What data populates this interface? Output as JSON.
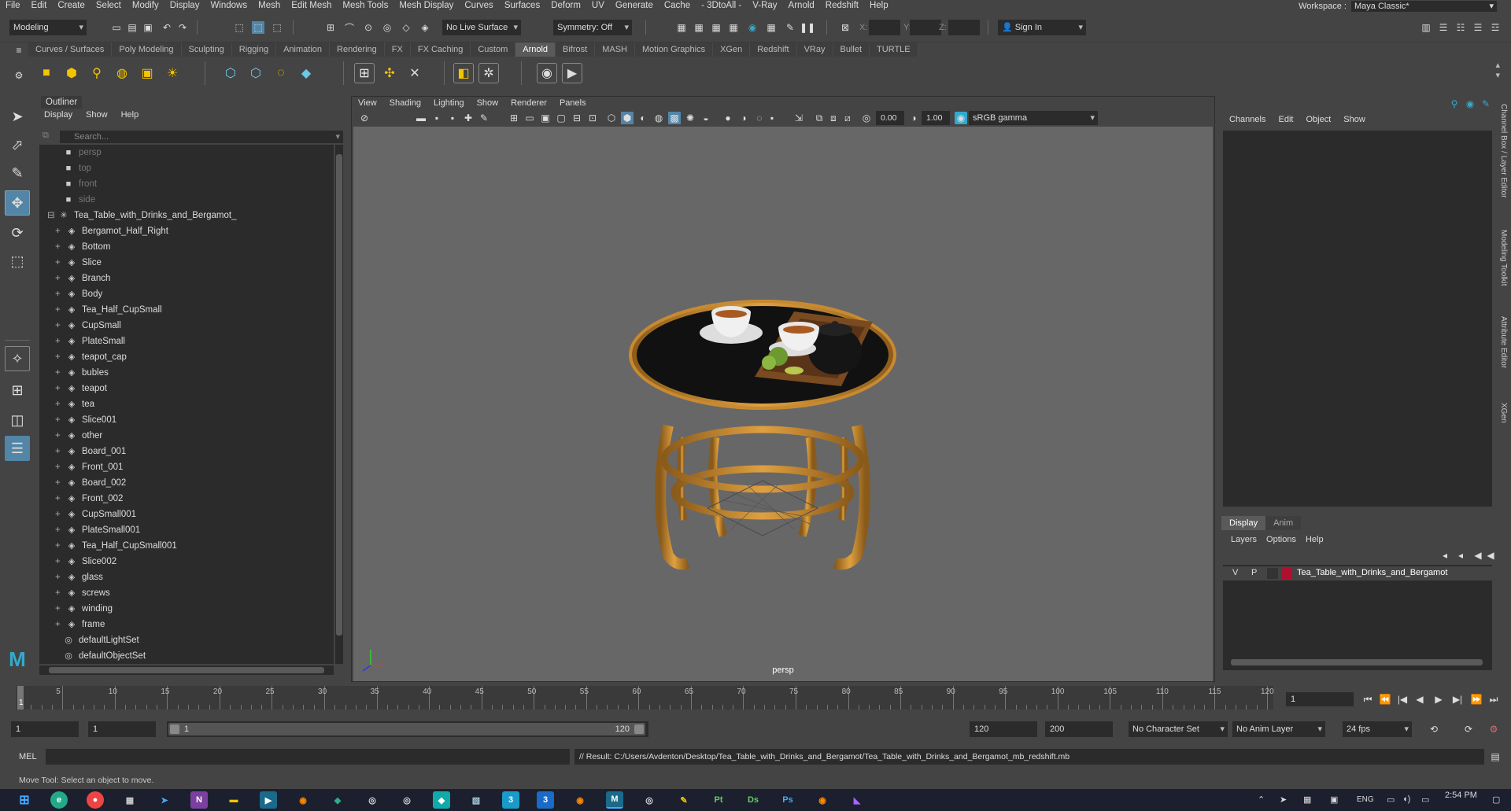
{
  "menubar": [
    "File",
    "Edit",
    "Create",
    "Select",
    "Modify",
    "Display",
    "Windows",
    "Mesh",
    "Edit Mesh",
    "Mesh Tools",
    "Mesh Display",
    "Curves",
    "Surfaces",
    "Deform",
    "UV",
    "Generate",
    "Cache",
    "- 3DtoAll -",
    "V-Ray",
    "Arnold",
    "Redshift",
    "Help"
  ],
  "workspace": {
    "label": "Workspace :",
    "value": "Maya Classic*"
  },
  "statusline": {
    "mode": "Modeling",
    "live_surface": "No Live Surface",
    "symmetry": "Symmetry: Off",
    "x_label": "X:",
    "y_label": "Y:",
    "z_label": "Z:",
    "sign_in": "Sign In"
  },
  "shelf_tabs": [
    "Curves / Surfaces",
    "Poly Modeling",
    "Sculpting",
    "Rigging",
    "Animation",
    "Rendering",
    "FX",
    "FX Caching",
    "Custom",
    "Arnold",
    "Bifrost",
    "MASH",
    "Motion Graphics",
    "XGen",
    "Redshift",
    "VRay",
    "Bullet",
    "TURTLE"
  ],
  "shelf_active": "Arnold",
  "outliner": {
    "title": "Outliner",
    "menu": [
      "Display",
      "Show",
      "Help"
    ],
    "search_placeholder": "Search...",
    "cameras": [
      "persp",
      "top",
      "front",
      "side"
    ],
    "group": "Tea_Table_with_Drinks_and_Bergamot_",
    "children": [
      "Bergamot_Half_Right",
      "Bottom",
      "Slice",
      "Branch",
      "Body",
      "Tea_Half_CupSmall",
      "CupSmall",
      "PlateSmall",
      "teapot_cap",
      "bubles",
      "teapot",
      "tea",
      "Slice001",
      "other",
      "Board_001",
      "Front_001",
      "Board_002",
      "Front_002",
      "CupSmall001",
      "PlateSmall001",
      "Tea_Half_CupSmall001",
      "Slice002",
      "glass",
      "screws",
      "winding",
      "frame"
    ],
    "sets": [
      "defaultLightSet",
      "defaultObjectSet"
    ]
  },
  "viewport": {
    "menu": [
      "View",
      "Shading",
      "Lighting",
      "Show",
      "Renderer",
      "Panels"
    ],
    "field_a": "0.00",
    "field_b": "1.00",
    "color_space": "sRGB gamma",
    "camera_label": "persp"
  },
  "channel_box": {
    "menu": [
      "Channels",
      "Edit",
      "Object",
      "Show"
    ],
    "layer_tabs": [
      "Display",
      "Anim"
    ],
    "layer_menu": [
      "Layers",
      "Options",
      "Help"
    ],
    "layer": {
      "v": "V",
      "p": "P",
      "name": "Tea_Table_with_Drinks_and_Bergamot",
      "color": "#b01030"
    }
  },
  "side_tabs": [
    "Channel Box / Layer Editor",
    "Modeling Toolkit",
    "Attribute Editor",
    "XGen"
  ],
  "timeline": {
    "ticks": [
      "5",
      "10",
      "15",
      "20",
      "25",
      "30",
      "35",
      "40",
      "45",
      "50",
      "55",
      "60",
      "65",
      "70",
      "75",
      "80",
      "85",
      "90",
      "95",
      "100",
      "105",
      "110",
      "115",
      "120"
    ],
    "current_frame": "1",
    "frame_field": "1"
  },
  "range": {
    "start": "1",
    "start2": "1",
    "slider_start": "1",
    "slider_end": "120",
    "end": "120",
    "end2": "200",
    "character_set": "No Character Set",
    "anim_layer": "No Anim Layer",
    "fps": "24 fps"
  },
  "cmdline": {
    "lang": "MEL",
    "result": "// Result: C:/Users/Avdenton/Desktop/Tea_Table_with_Drinks_and_Bergamot/Tea_Table_with_Drinks_and_Bergamot_mb_redshift.mb"
  },
  "helpline": "Move Tool: Select an object to move.",
  "taskbar": {
    "lang": "ENG",
    "time": "2:54 PM"
  }
}
